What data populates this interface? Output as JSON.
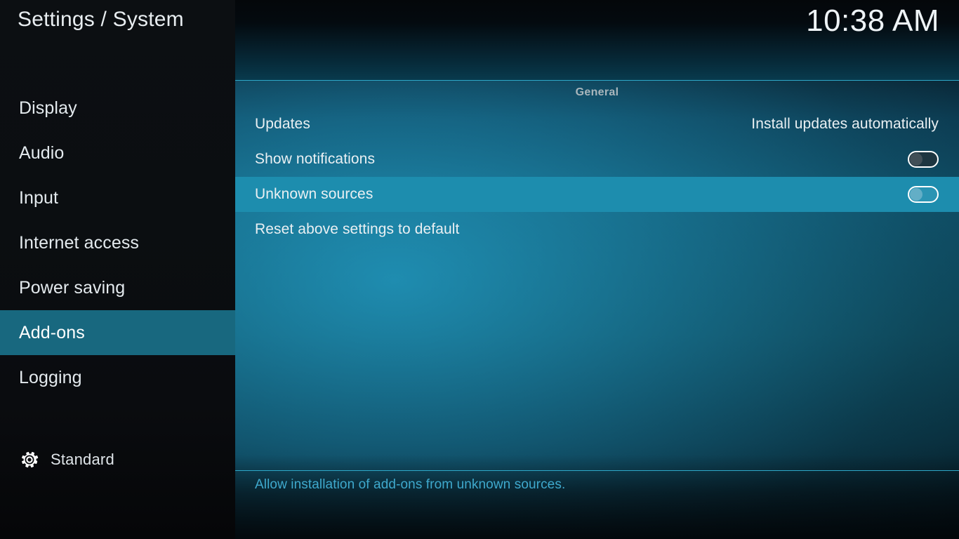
{
  "window": {
    "title": "Settings / System",
    "clock": "10:38 AM"
  },
  "colors": {
    "accent_highlight": "#1d8dae",
    "sidebar_highlight": "#18687f",
    "separator": "#2ea8c8",
    "description_text": "#3fa9cd",
    "primary_text": "#eaf0f3",
    "group_header_text": "#a9b6bc"
  },
  "sidebar": {
    "items": [
      {
        "label": "Display",
        "selected": false
      },
      {
        "label": "Audio",
        "selected": false
      },
      {
        "label": "Input",
        "selected": false
      },
      {
        "label": "Internet access",
        "selected": false
      },
      {
        "label": "Power saving",
        "selected": false
      },
      {
        "label": "Add-ons",
        "selected": true
      },
      {
        "label": "Logging",
        "selected": false
      }
    ],
    "profile": {
      "icon": "gear-icon",
      "label": "Standard"
    }
  },
  "main": {
    "group_header": "General",
    "rows": [
      {
        "label": "Updates",
        "kind": "value",
        "value": "Install updates automatically",
        "selected": false
      },
      {
        "label": "Show notifications",
        "kind": "toggle",
        "toggle_state": "off",
        "selected": false
      },
      {
        "label": "Unknown sources",
        "kind": "toggle",
        "toggle_state": "off",
        "selected": true
      },
      {
        "label": "Reset above settings to default",
        "kind": "action",
        "selected": false
      }
    ],
    "description": "Allow installation of add-ons from unknown sources."
  }
}
